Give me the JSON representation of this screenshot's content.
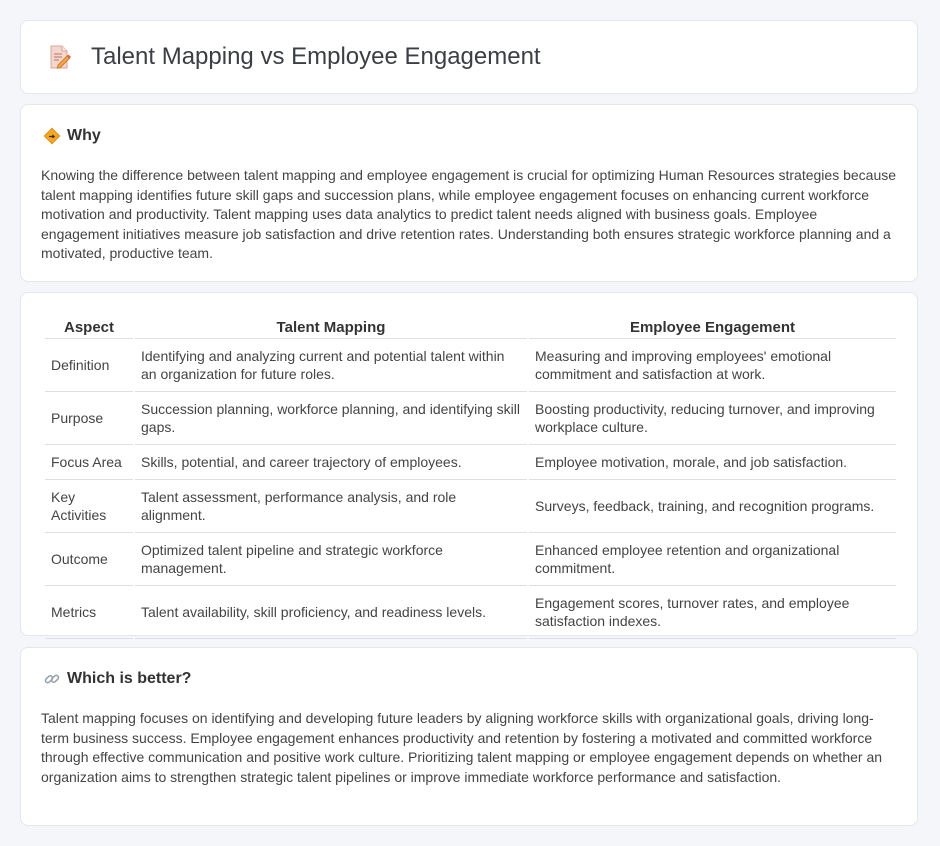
{
  "header": {
    "title": "Talent Mapping vs Employee Engagement",
    "icon": "edit-document-icon"
  },
  "why": {
    "heading": "Why",
    "icon": "warning-diamond-icon",
    "text": "Knowing the difference between talent mapping and employee engagement is crucial for optimizing Human Resources strategies because talent mapping identifies future skill gaps and succession plans, while employee engagement focuses on enhancing current workforce motivation and productivity. Talent mapping uses data analytics to predict talent needs aligned with business goals. Employee engagement initiatives measure job satisfaction and drive retention rates. Understanding both ensures strategic workforce planning and a motivated, productive team."
  },
  "table": {
    "headers": [
      "Aspect",
      "Talent Mapping",
      "Employee Engagement"
    ],
    "rows": [
      {
        "aspect": "Definition",
        "tm": "Identifying and analyzing current and potential talent within an organization for future roles.",
        "ee": "Measuring and improving employees' emotional commitment and satisfaction at work."
      },
      {
        "aspect": "Purpose",
        "tm": "Succession planning, workforce planning, and identifying skill gaps.",
        "ee": "Boosting productivity, reducing turnover, and improving workplace culture."
      },
      {
        "aspect": "Focus Area",
        "tm": "Skills, potential, and career trajectory of employees.",
        "ee": "Employee motivation, morale, and job satisfaction."
      },
      {
        "aspect": "Key Activities",
        "tm": "Talent assessment, performance analysis, and role alignment.",
        "ee": "Surveys, feedback, training, and recognition programs."
      },
      {
        "aspect": "Outcome",
        "tm": "Optimized talent pipeline and strategic workforce management.",
        "ee": "Enhanced employee retention and organizational commitment."
      },
      {
        "aspect": "Metrics",
        "tm": "Talent availability, skill proficiency, and readiness levels.",
        "ee": "Engagement scores, turnover rates, and employee satisfaction indexes."
      }
    ]
  },
  "better": {
    "heading": "Which is better?",
    "icon": "link-icon",
    "text": "Talent mapping focuses on identifying and developing future leaders by aligning workforce skills with organizational goals, driving long-term business success. Employee engagement enhances productivity and retention by fostering a motivated and committed workforce through effective communication and positive work culture. Prioritizing talent mapping or employee engagement depends on whether an organization aims to strengthen strategic talent pipelines or improve immediate workforce performance and satisfaction."
  }
}
